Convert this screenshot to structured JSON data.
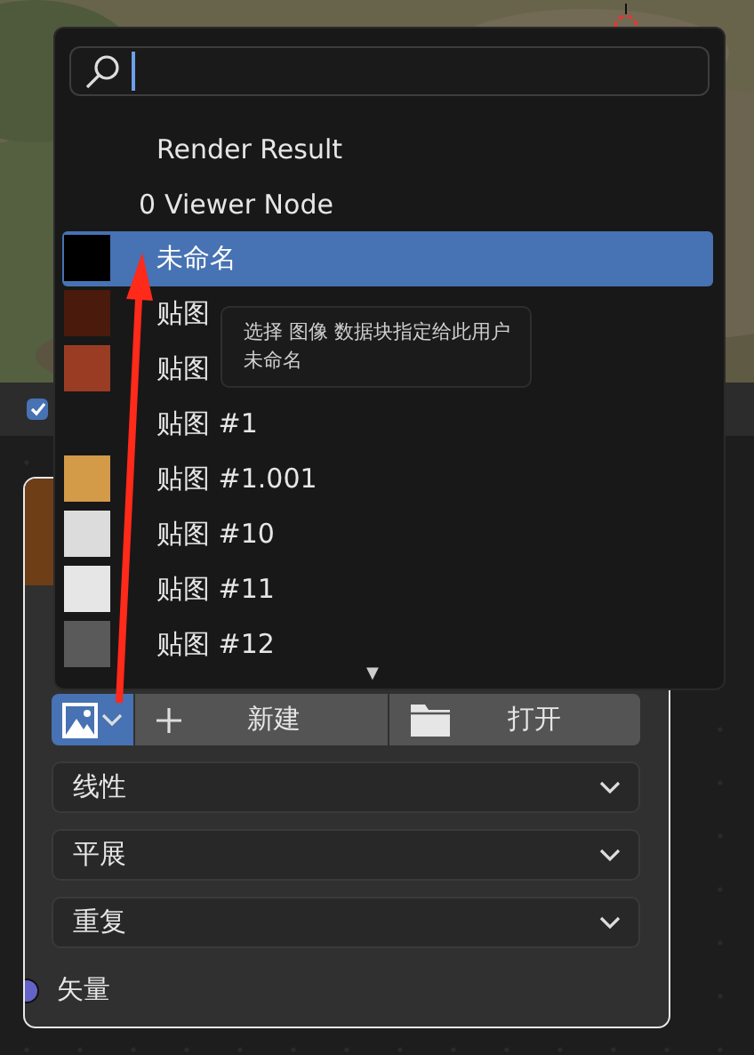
{
  "search_field": {
    "focused": true
  },
  "items": [
    {
      "name": "Render Result",
      "selected": false
    },
    {
      "users": "0",
      "name": "Viewer Node",
      "selected": false
    },
    {
      "name": "未命名",
      "color": "#000000",
      "selected": true
    },
    {
      "name": "贴图",
      "color": "#4a1a0c",
      "selected": false
    },
    {
      "name": "贴图",
      "color": "#9a3c24",
      "selected": false
    },
    {
      "name": "贴图 #1",
      "selected": false
    },
    {
      "name": "贴图 #1.001",
      "color": "#d39a48",
      "selected": false
    },
    {
      "name": "贴图 #10",
      "color": "#dcdcdc",
      "selected": false
    },
    {
      "name": "贴图 #11",
      "color": "#e6e6e6",
      "selected": false
    },
    {
      "name": "贴图 #12",
      "color": "#5a5a5a",
      "selected": false
    }
  ],
  "more_below": "▼",
  "tooltip": {
    "lines": [
      "选择 图像 数据块指定给此用户",
      "未命名"
    ]
  },
  "header": {
    "checked": true
  },
  "node": {
    "buttons": [
      "新建",
      "打开"
    ],
    "selects": [
      "线性",
      "平展",
      "重复"
    ],
    "socket": {
      "label": "矢量",
      "color": "#6363c7"
    }
  }
}
